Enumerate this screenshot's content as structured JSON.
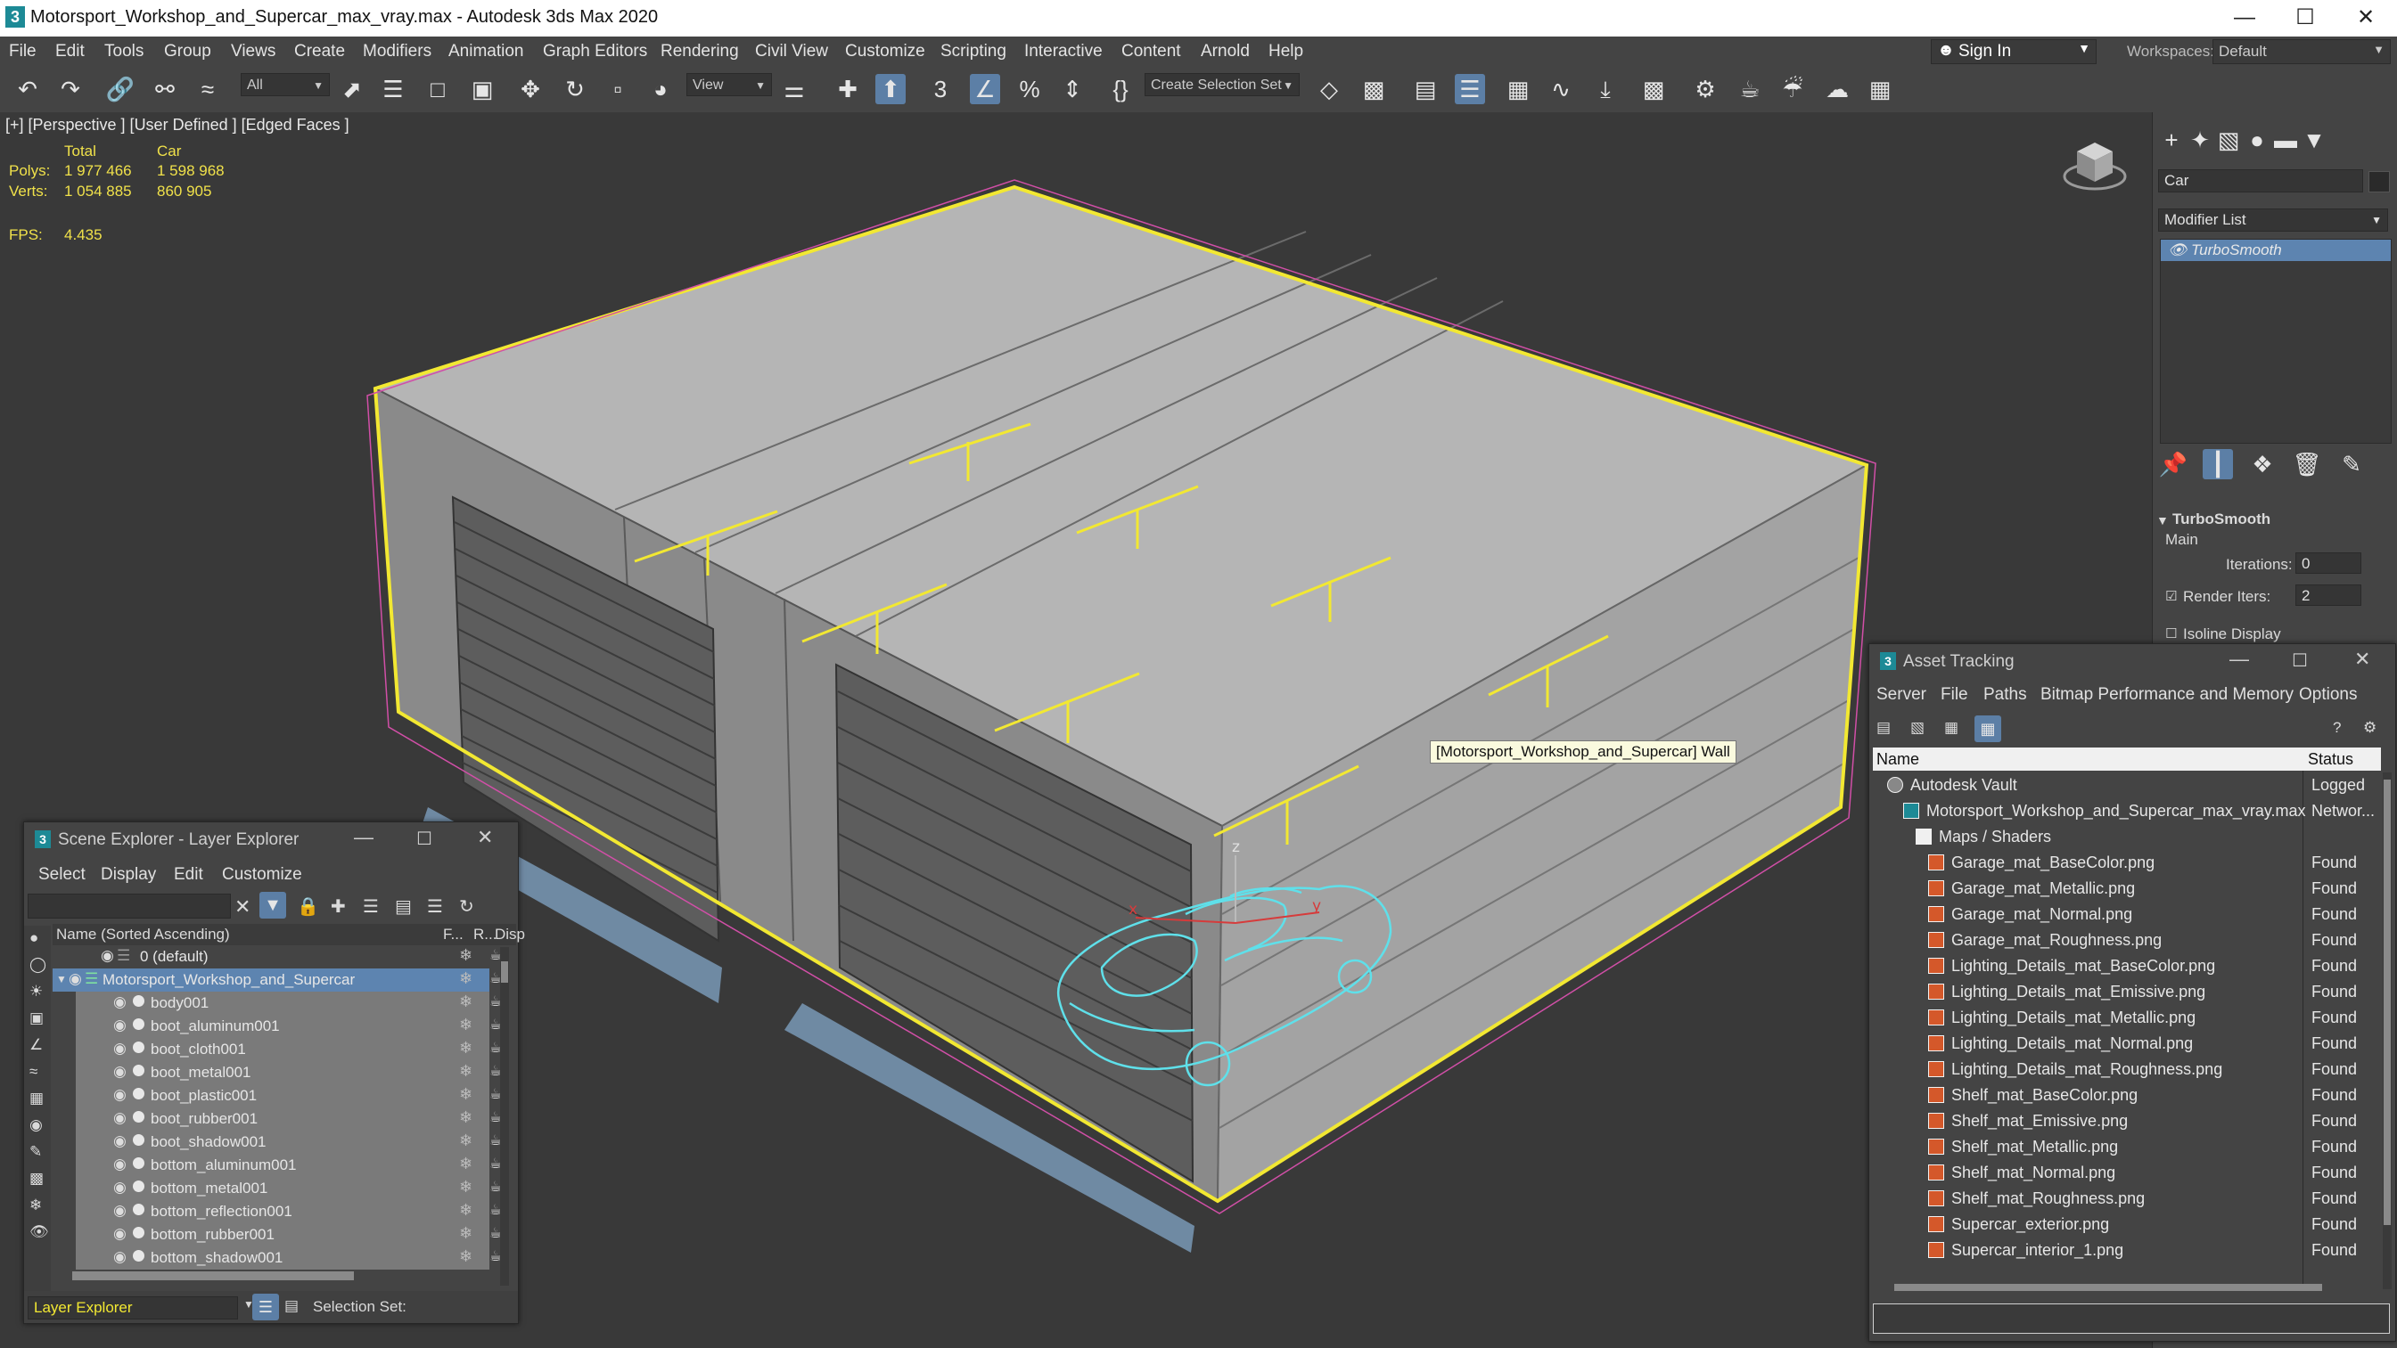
{
  "window": {
    "title": "Motorsport_Workshop_and_Supercar_max_vray.max - Autodesk 3ds Max 2020",
    "app_icon": "3"
  },
  "menu": [
    "File",
    "Edit",
    "Tools",
    "Group",
    "Views",
    "Create",
    "Modifiers",
    "Animation",
    "Graph Editors",
    "Rendering",
    "Civil View",
    "Customize",
    "Scripting",
    "Interactive",
    "Content",
    "Arnold",
    "Help"
  ],
  "account": {
    "sign_in": "Sign In",
    "workspaces_label": "Workspaces:",
    "workspace": "Default"
  },
  "toolbar": {
    "filter": "All",
    "ref_coord": "View",
    "selection_set": "Create Selection Set",
    "snap_angle_label": "3"
  },
  "viewport": {
    "label": "[+] [Perspective ] [User Defined ] [Edged Faces ]",
    "stats": {
      "col_total": "Total",
      "col_car": "Car",
      "polys_label": "Polys:",
      "polys_total": "1 977 466",
      "polys_car": "1 598 968",
      "verts_label": "Verts:",
      "verts_total": "1 054 885",
      "verts_car": "860 905",
      "fps_label": "FPS:",
      "fps": "4.435"
    },
    "tooltip": "[Motorsport_Workshop_and_Supercar] Wall",
    "axis_labels": [
      "z",
      "x",
      "y"
    ]
  },
  "command_panel": {
    "object_name": "Car",
    "modifier_list": "Modifier List",
    "stack_item": "TurboSmooth",
    "rollout_title": "TurboSmooth",
    "group_main": "Main",
    "iterations_label": "Iterations:",
    "iterations": "0",
    "render_iters_label": "Render Iters:",
    "render_iters": "2",
    "isoline": "Isoline Display"
  },
  "scene_explorer": {
    "title": "Scene Explorer - Layer Explorer",
    "menu": [
      "Select",
      "Display",
      "Edit",
      "Customize"
    ],
    "col_name": "Name (Sorted Ascending)",
    "col_f": "F...",
    "col_r": "R...",
    "col_disp": "Disp",
    "rows": [
      {
        "name": "0 (default)",
        "level": 0,
        "type": "layer"
      },
      {
        "name": "Motorsport_Workshop_and_Supercar",
        "level": 0,
        "type": "layer-selected"
      },
      {
        "name": "body001",
        "level": 1,
        "type": "obj"
      },
      {
        "name": "boot_aluminum001",
        "level": 1,
        "type": "obj"
      },
      {
        "name": "boot_cloth001",
        "level": 1,
        "type": "obj"
      },
      {
        "name": "boot_metal001",
        "level": 1,
        "type": "obj"
      },
      {
        "name": "boot_plastic001",
        "level": 1,
        "type": "obj"
      },
      {
        "name": "boot_rubber001",
        "level": 1,
        "type": "obj"
      },
      {
        "name": "boot_shadow001",
        "level": 1,
        "type": "obj"
      },
      {
        "name": "bottom_aluminum001",
        "level": 1,
        "type": "obj"
      },
      {
        "name": "bottom_metal001",
        "level": 1,
        "type": "obj"
      },
      {
        "name": "bottom_reflection001",
        "level": 1,
        "type": "obj"
      },
      {
        "name": "bottom_rubber001",
        "level": 1,
        "type": "obj"
      },
      {
        "name": "bottom_shadow001",
        "level": 1,
        "type": "obj"
      }
    ],
    "footer_layer": "Layer Explorer",
    "footer_selection": "Selection Set:"
  },
  "asset_tracking": {
    "title": "Asset Tracking",
    "menu": [
      "Server",
      "File",
      "Paths",
      "Bitmap Performance and Memory",
      "Options"
    ],
    "col_name": "Name",
    "col_status": "Status",
    "rows": [
      {
        "name": "Autodesk Vault",
        "status": "Logged",
        "level": 0,
        "icon": "vault"
      },
      {
        "name": "Motorsport_Workshop_and_Supercar_max_vray.max",
        "status": "Networ...",
        "level": 1,
        "icon": "max"
      },
      {
        "name": "Maps / Shaders",
        "status": "",
        "level": 2,
        "icon": "folder"
      },
      {
        "name": "Garage_mat_BaseColor.png",
        "status": "Found",
        "level": 3,
        "icon": "bitmap"
      },
      {
        "name": "Garage_mat_Metallic.png",
        "status": "Found",
        "level": 3,
        "icon": "bitmap"
      },
      {
        "name": "Garage_mat_Normal.png",
        "status": "Found",
        "level": 3,
        "icon": "bitmap"
      },
      {
        "name": "Garage_mat_Roughness.png",
        "status": "Found",
        "level": 3,
        "icon": "bitmap"
      },
      {
        "name": "Lighting_Details_mat_BaseColor.png",
        "status": "Found",
        "level": 3,
        "icon": "bitmap"
      },
      {
        "name": "Lighting_Details_mat_Emissive.png",
        "status": "Found",
        "level": 3,
        "icon": "bitmap"
      },
      {
        "name": "Lighting_Details_mat_Metallic.png",
        "status": "Found",
        "level": 3,
        "icon": "bitmap"
      },
      {
        "name": "Lighting_Details_mat_Normal.png",
        "status": "Found",
        "level": 3,
        "icon": "bitmap"
      },
      {
        "name": "Lighting_Details_mat_Roughness.png",
        "status": "Found",
        "level": 3,
        "icon": "bitmap"
      },
      {
        "name": "Shelf_mat_BaseColor.png",
        "status": "Found",
        "level": 3,
        "icon": "bitmap"
      },
      {
        "name": "Shelf_mat_Emissive.png",
        "status": "Found",
        "level": 3,
        "icon": "bitmap"
      },
      {
        "name": "Shelf_mat_Metallic.png",
        "status": "Found",
        "level": 3,
        "icon": "bitmap"
      },
      {
        "name": "Shelf_mat_Normal.png",
        "status": "Found",
        "level": 3,
        "icon": "bitmap"
      },
      {
        "name": "Shelf_mat_Roughness.png",
        "status": "Found",
        "level": 3,
        "icon": "bitmap"
      },
      {
        "name": "Supercar_exterior.png",
        "status": "Found",
        "level": 3,
        "icon": "bitmap"
      },
      {
        "name": "Supercar_interior_1.png",
        "status": "Found",
        "level": 3,
        "icon": "bitmap"
      }
    ]
  },
  "colors": {
    "ui_bg": "#444444",
    "viewport_bg": "#393939",
    "selection_yellow": "#f2e832",
    "highlight_blue": "#5d84b0",
    "car_wire": "#5fe0ea"
  }
}
